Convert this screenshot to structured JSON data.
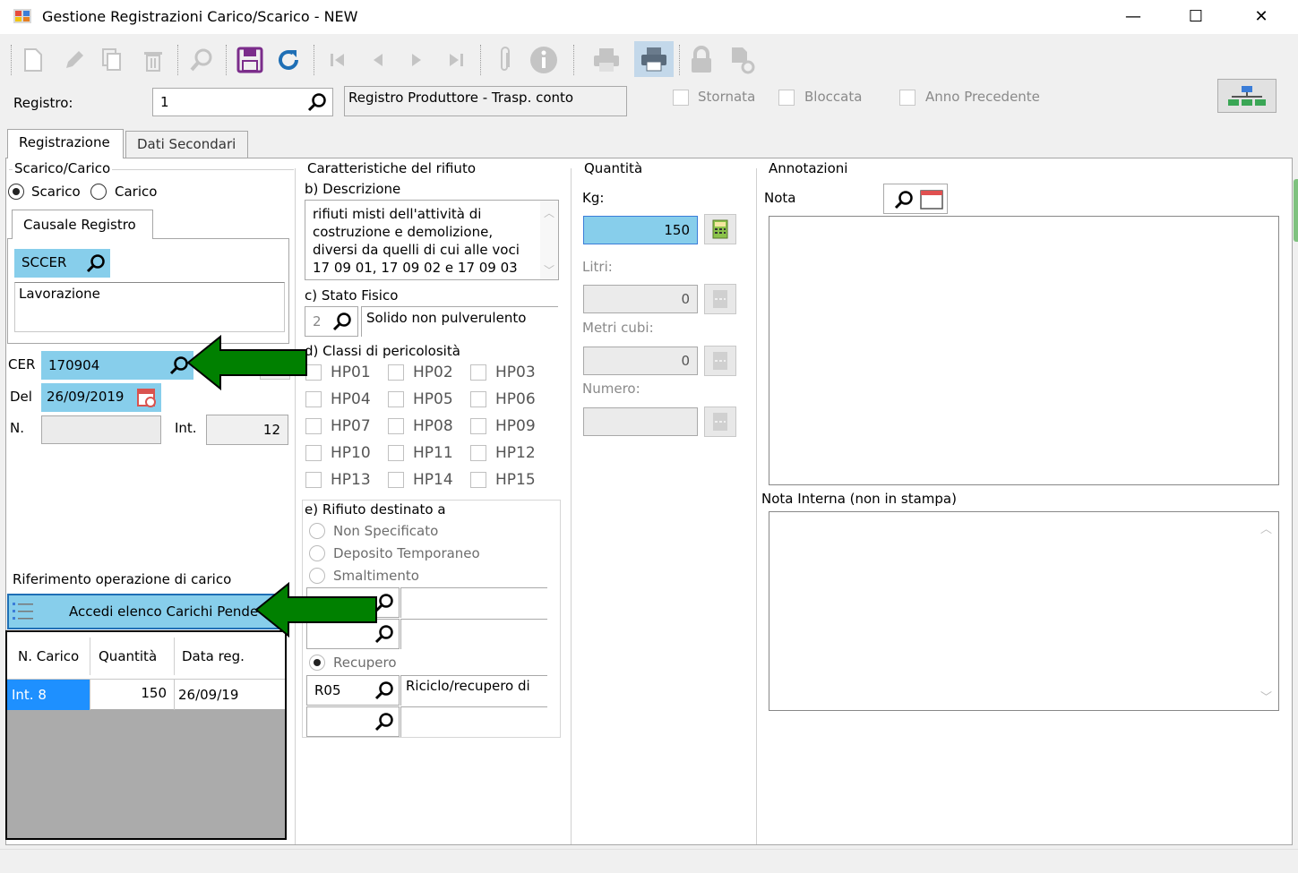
{
  "window": {
    "title": "Gestione Registrazioni Carico/Scarico - NEW",
    "minimize": "—",
    "maximize": "☐",
    "close": "✕"
  },
  "toolbar_icons": [
    "new-icon",
    "edit-icon",
    "copy-icon",
    "delete-icon",
    "search-icon",
    "save-icon",
    "refresh-icon",
    "first-icon",
    "prev-icon",
    "next-icon",
    "last-icon",
    "attach-icon",
    "info-icon",
    "print-icon",
    "print-active-icon",
    "lock-icon",
    "settings-icon"
  ],
  "registro": {
    "label": "Registro:",
    "value": "1",
    "description": "Registro Produttore - Trasp. conto",
    "stornata": "Stornata",
    "bloccata": "Bloccata",
    "anno_precedente": "Anno Precedente"
  },
  "tabs": [
    "Registrazione",
    "Dati Secondari"
  ],
  "scarico_carico": {
    "legend": "Scarico/Carico",
    "scarico": "Scarico",
    "carico": "Carico",
    "selected": "Scarico"
  },
  "causale": {
    "tab": "Causale Registro",
    "code": "SCCER",
    "description": "Lavorazione"
  },
  "cer": {
    "label": "CER",
    "value": "170904"
  },
  "del": {
    "label": "Del",
    "value": "26/09/2019"
  },
  "numero": {
    "label": "N.",
    "value": "",
    "int_label": "Int.",
    "int_value": "12"
  },
  "riferimento": {
    "label": "Riferimento operazione di carico",
    "button": "Accedi elenco Carichi Pende",
    "columns": [
      "N. Carico",
      "Quantità",
      "Data reg."
    ],
    "rows": [
      [
        "Int. 8",
        "150",
        "26/09/19"
      ]
    ]
  },
  "caratteristiche": {
    "legend": "Caratteristiche del rifiuto",
    "descrizione_label": "b) Descrizione",
    "descrizione_lines": [
      "rifiuti misti dell'attività di",
      "costruzione e demolizione,",
      "diversi da quelli di cui alle voci",
      "17 09 01, 17 09 02 e 17 09 03"
    ],
    "stato_label": "c) Stato Fisico",
    "stato_code": "2",
    "stato_desc": "Solido non pulverulento",
    "classi_label": "d) Classi di pericolosità",
    "hp": [
      "HP01",
      "HP02",
      "HP03",
      "HP04",
      "HP05",
      "HP06",
      "HP07",
      "HP08",
      "HP09",
      "HP10",
      "HP11",
      "HP12",
      "HP13",
      "HP14",
      "HP15"
    ],
    "destinato_label": "e) Rifiuto destinato a",
    "non_specificato": "Non Specificato",
    "deposito": "Deposito Temporaneo",
    "smaltimento": "Smaltimento",
    "recupero": "Recupero",
    "recupero_code": "R05",
    "recupero_desc": "Riciclo/recupero di"
  },
  "quantita": {
    "legend": "Quantità",
    "kg_label": "Kg:",
    "kg_value": "150",
    "litri_label": "Litri:",
    "litri_value": "0",
    "metri_label": "Metri cubi:",
    "metri_value": "0",
    "numero_label": "Numero:",
    "numero_value": ""
  },
  "annotazioni": {
    "legend": "Annotazioni",
    "nota_label": "Nota",
    "nota_value": "",
    "nota_interna_label": "Nota Interna (non in stampa)",
    "nota_interna_value": ""
  },
  "colors": {
    "highlight": "#87ceeb",
    "selected_row": "#1e90ff",
    "arrow": "#008000",
    "save": "#7b2d8b",
    "refresh": "#1f6fb5"
  }
}
